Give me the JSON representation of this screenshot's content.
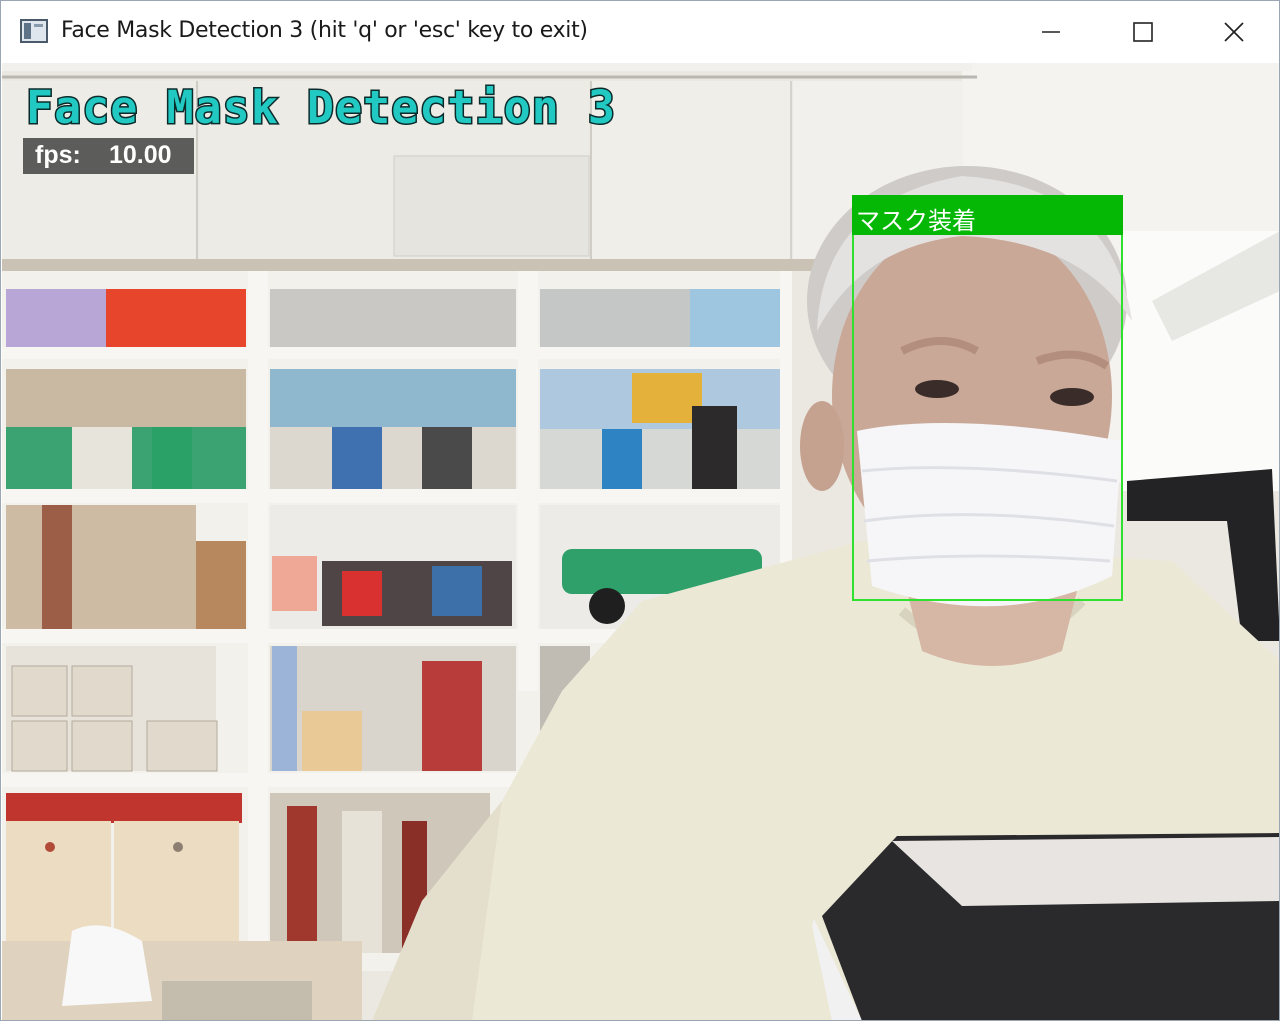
{
  "window": {
    "title": "Face Mask Detection 3  (hit 'q' or 'esc' key to exit)",
    "controls": {
      "minimize_icon": "minimize-icon",
      "maximize_icon": "maximize-icon",
      "close_icon": "close-icon"
    }
  },
  "overlay": {
    "title": "Face Mask Detection 3",
    "fps_label": "fps:",
    "fps_value": "10.00",
    "title_color": "#21c9c2",
    "fps_background": "#484848"
  },
  "detection": {
    "label": "マスク装着",
    "box_color": "#2fe02f",
    "label_background": "#06b806"
  }
}
